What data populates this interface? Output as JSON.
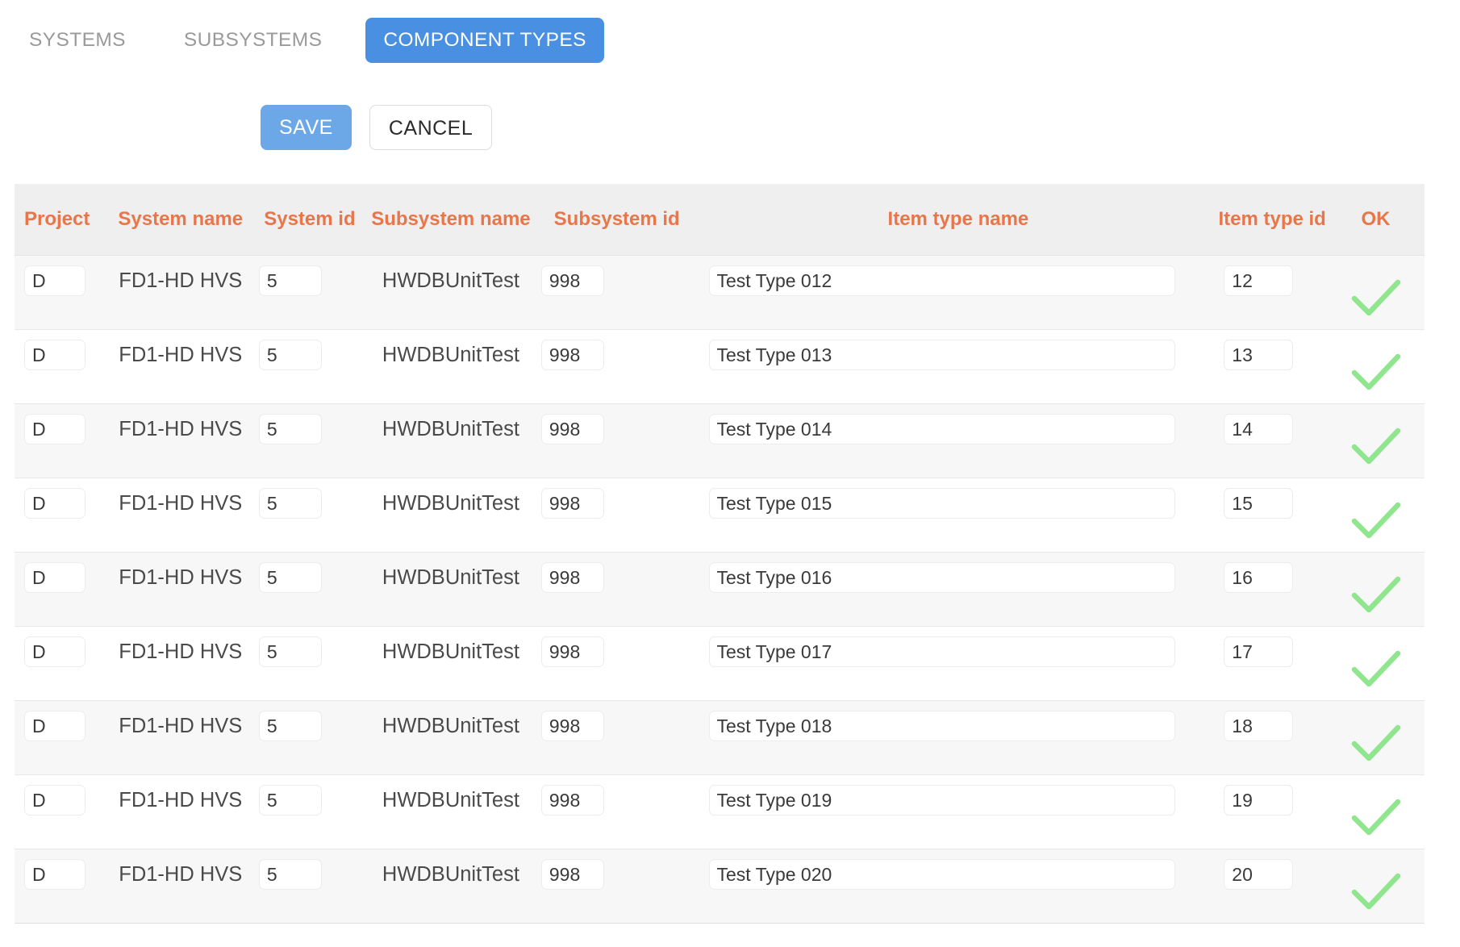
{
  "tabs": [
    {
      "label": "SYSTEMS",
      "active": false
    },
    {
      "label": "SUBSYSTEMS",
      "active": false
    },
    {
      "label": "COMPONENT TYPES",
      "active": true
    }
  ],
  "toolbar": {
    "save_label": "SAVE",
    "cancel_label": "CANCEL"
  },
  "colors": {
    "tab_active_blue": "#4a90e2",
    "save_blue": "#6ca7e8",
    "header_orange": "#e8764a",
    "header_bg": "#efefef",
    "row_alt_bg": "#f7f7f7",
    "check_green": "#90e58f"
  },
  "table": {
    "columns": [
      {
        "key": "project",
        "label": "Project"
      },
      {
        "key": "system_name",
        "label": "System name"
      },
      {
        "key": "system_id",
        "label": "System id"
      },
      {
        "key": "subsystem_name",
        "label": "Subsystem name"
      },
      {
        "key": "subsystem_id",
        "label": "Subsystem id"
      },
      {
        "key": "item_type_name",
        "label": "Item type name"
      },
      {
        "key": "item_type_id",
        "label": "Item type id"
      },
      {
        "key": "ok",
        "label": "OK"
      }
    ],
    "rows": [
      {
        "project": "D",
        "system_name": "FD1-HD HVS",
        "system_id": "5",
        "subsystem_name": "HWDBUnitTest",
        "subsystem_id": "998",
        "item_type_name": "Test Type 012",
        "item_type_id": "12",
        "ok": "check"
      },
      {
        "project": "D",
        "system_name": "FD1-HD HVS",
        "system_id": "5",
        "subsystem_name": "HWDBUnitTest",
        "subsystem_id": "998",
        "item_type_name": "Test Type 013",
        "item_type_id": "13",
        "ok": "check"
      },
      {
        "project": "D",
        "system_name": "FD1-HD HVS",
        "system_id": "5",
        "subsystem_name": "HWDBUnitTest",
        "subsystem_id": "998",
        "item_type_name": "Test Type 014",
        "item_type_id": "14",
        "ok": "check"
      },
      {
        "project": "D",
        "system_name": "FD1-HD HVS",
        "system_id": "5",
        "subsystem_name": "HWDBUnitTest",
        "subsystem_id": "998",
        "item_type_name": "Test Type 015",
        "item_type_id": "15",
        "ok": "check"
      },
      {
        "project": "D",
        "system_name": "FD1-HD HVS",
        "system_id": "5",
        "subsystem_name": "HWDBUnitTest",
        "subsystem_id": "998",
        "item_type_name": "Test Type 016",
        "item_type_id": "16",
        "ok": "check"
      },
      {
        "project": "D",
        "system_name": "FD1-HD HVS",
        "system_id": "5",
        "subsystem_name": "HWDBUnitTest",
        "subsystem_id": "998",
        "item_type_name": "Test Type 017",
        "item_type_id": "17",
        "ok": "check"
      },
      {
        "project": "D",
        "system_name": "FD1-HD HVS",
        "system_id": "5",
        "subsystem_name": "HWDBUnitTest",
        "subsystem_id": "998",
        "item_type_name": "Test Type 018",
        "item_type_id": "18",
        "ok": "check"
      },
      {
        "project": "D",
        "system_name": "FD1-HD HVS",
        "system_id": "5",
        "subsystem_name": "HWDBUnitTest",
        "subsystem_id": "998",
        "item_type_name": "Test Type 019",
        "item_type_id": "19",
        "ok": "check"
      },
      {
        "project": "D",
        "system_name": "FD1-HD HVS",
        "system_id": "5",
        "subsystem_name": "HWDBUnitTest",
        "subsystem_id": "998",
        "item_type_name": "Test Type 020",
        "item_type_id": "20",
        "ok": "check"
      }
    ]
  }
}
